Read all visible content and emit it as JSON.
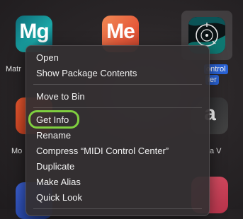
{
  "desktop": {
    "apps": [
      {
        "icon_letters": "Mg",
        "label": "Matr",
        "icon": "app-icon"
      },
      {
        "icon_letters": "Me",
        "label": "",
        "icon": "app-icon"
      },
      {
        "icon_letters": "",
        "label": "MIDI Control Center",
        "label_line1": "ontrol",
        "label_line2": "ter",
        "icon": "midi-control-center-icon"
      },
      {
        "icon_letters": "",
        "label": "Mo",
        "icon": "app-icon"
      },
      {
        "icon_letters": "a",
        "label": "a V",
        "icon": "app-icon"
      }
    ]
  },
  "context_menu": {
    "items": [
      {
        "label": "Open"
      },
      {
        "label": "Show Package Contents"
      },
      {
        "label": "Move to Bin"
      },
      {
        "label": "Get Info",
        "highlighted": true
      },
      {
        "label": "Rename"
      },
      {
        "label": "Compress “MIDI Control Center”"
      },
      {
        "label": "Duplicate"
      },
      {
        "label": "Make Alias"
      },
      {
        "label": "Quick Look"
      }
    ]
  },
  "colors": {
    "selection_blue": "#2a63d6",
    "highlight_green": "#7fcf3f"
  }
}
